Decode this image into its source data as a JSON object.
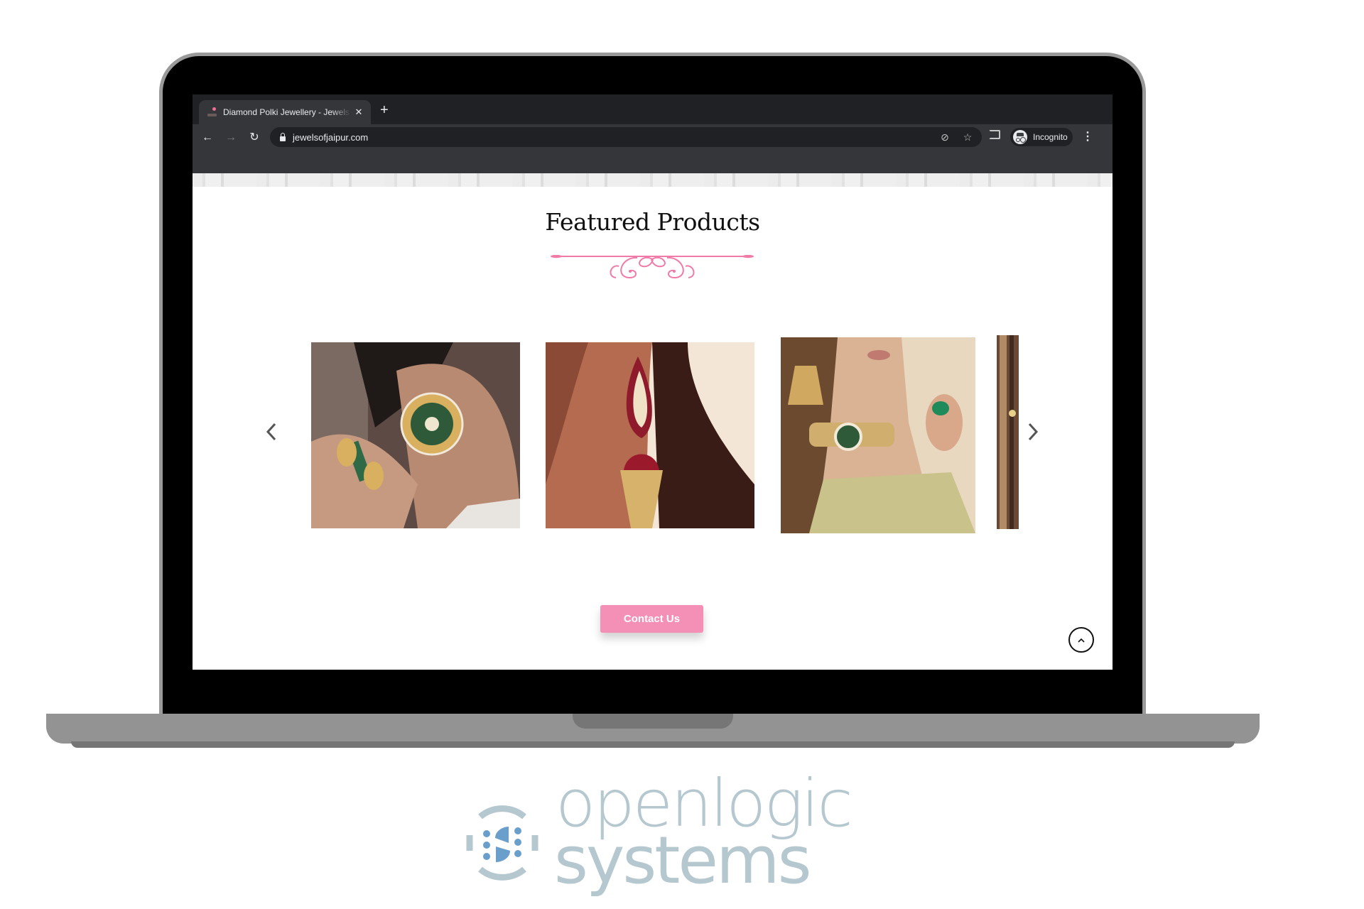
{
  "browser": {
    "tab": {
      "title": "Diamond Polki Jewellery - Jewels of Jaipur",
      "close_icon": "close-icon"
    },
    "new_tab_label": "+",
    "nav": {
      "back": "←",
      "forward": "→",
      "reload": "↻"
    },
    "url": "jewelsofjaipur.com",
    "omnibox_icons": [
      "eye-slash-icon",
      "star-icon"
    ],
    "eye_slash_glyph": "⊘",
    "star_glyph": "☆",
    "incognito_label": "Incognito",
    "menu_glyph": "⋮"
  },
  "page": {
    "section_title": "Featured Products",
    "accent_color": "#f07aa8",
    "products": [
      {
        "name": "Round polki stud earring and emerald ring",
        "colors": [
          "#5e4a44",
          "#b98a72",
          "#2f5a3a",
          "#d8b060"
        ]
      },
      {
        "name": "Ruby paisley ear cuff with jhumka",
        "colors": [
          "#3a1c17",
          "#b46b4f",
          "#8e1a2c",
          "#f3e6d6"
        ]
      },
      {
        "name": "Polki choker and chandelier earrings set",
        "colors": [
          "#6b4a30",
          "#d9b394",
          "#c9c28a",
          "#e8d8c0"
        ]
      },
      {
        "name": "Partial product image",
        "colors": [
          "#6a4a35",
          "#b08b66"
        ]
      }
    ],
    "prev_label": "‹",
    "next_label": "›",
    "contact_button": "Contact Us",
    "contact_color": "#f48fb5",
    "scroll_top_glyph": "^"
  },
  "branding": {
    "line1": "openlogic",
    "line2": "systems",
    "text_color": "#b5c8cf",
    "icon_color": "#6a9ecb"
  }
}
